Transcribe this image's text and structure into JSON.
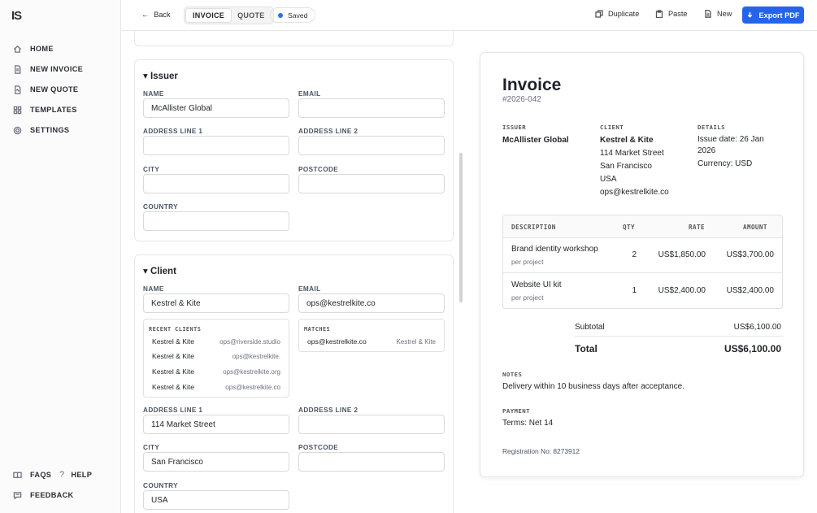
{
  "app": {
    "logo": "IS"
  },
  "sidebar": {
    "items": [
      {
        "label": "HOME",
        "icon": "home-icon"
      },
      {
        "label": "NEW INVOICE",
        "icon": "document-icon"
      },
      {
        "label": "NEW QUOTE",
        "icon": "quote-icon"
      },
      {
        "label": "TEMPLATES",
        "icon": "grid-icon"
      },
      {
        "label": "SETTINGS",
        "icon": "gear-icon"
      }
    ],
    "bottom": {
      "faqs": "FAQS",
      "help": "HELP",
      "feedback": "FEEDBACK"
    }
  },
  "toolbar": {
    "back": "Back",
    "tabs": [
      "INVOICE",
      "QUOTE"
    ],
    "saved": "Saved",
    "duplicate": "Duplicate",
    "paste": "Paste",
    "new": "New",
    "export": "Export PDF"
  },
  "issuer": {
    "title": "Issuer",
    "name_label": "NAME",
    "name": "McAllister Global",
    "email_label": "EMAIL",
    "email": "",
    "address1_label": "ADDRESS LINE 1",
    "address1": "",
    "address2_label": "ADDRESS LINE 2",
    "address2": "",
    "city_label": "CITY",
    "city": "",
    "postcode_label": "POSTCODE",
    "postcode": "",
    "country_label": "COUNTRY",
    "country": ""
  },
  "client": {
    "title": "Client",
    "name_label": "NAME",
    "name": "Kestrel & Kite",
    "email_label": "EMAIL",
    "email": "ops@kestrelkite.co",
    "recent_title": "RECENT CLIENTS",
    "recent": [
      {
        "name": "Kestrel & Kite",
        "email": "ops@riverside.studio"
      },
      {
        "name": "Kestrel & Kite",
        "email": "ops@kestrelkite."
      },
      {
        "name": "Kestrel & Kite",
        "email": "ops@kestrelkite.org"
      },
      {
        "name": "Kestrel & Kite",
        "email": "ops@kestrelkite.co"
      }
    ],
    "matches_title": "MATCHES",
    "matches": [
      {
        "email": "ops@kestrelkite.co",
        "name": "Kestrel & Kite"
      }
    ],
    "address1_label": "ADDRESS LINE 1",
    "address1": "114 Market Street",
    "address2_label": "ADDRESS LINE 2",
    "address2": "",
    "city_label": "CITY",
    "city": "San Francisco",
    "postcode_label": "POSTCODE",
    "postcode": "",
    "country_label": "COUNTRY",
    "country": "USA"
  },
  "preview": {
    "title": "Invoice",
    "number": "#2026-042",
    "issuer_label": "ISSUER",
    "issuer_name": "McAllister Global",
    "client_label": "CLIENT",
    "client_name": "Kestrel & Kite",
    "client_lines": [
      "114 Market Street",
      "San Francisco",
      "USA",
      "ops@kestrelkite.co"
    ],
    "details_label": "DETAILS",
    "issue_date_line1": "Issue date: 26 Jan",
    "issue_date_line2": "2026",
    "currency": "Currency: USD",
    "table_headers": {
      "description": "DESCRIPTION",
      "qty": "QTY",
      "rate": "RATE",
      "amount": "AMOUNT"
    },
    "items": [
      {
        "description": "Brand identity workshop",
        "unit": "per project",
        "qty": "2",
        "rate": "US$1,850.00",
        "amount": "US$3,700.00"
      },
      {
        "description": "Website UI kit",
        "unit": "per project",
        "qty": "1",
        "rate": "US$2,400.00",
        "amount": "US$2,400.00"
      }
    ],
    "subtotal_label": "Subtotal",
    "subtotal": "US$6,100.00",
    "total_label": "Total",
    "total": "US$6,100.00",
    "notes_label": "NOTES",
    "notes": "Delivery within 10 business days after acceptance.",
    "payment_label": "PAYMENT",
    "payment": "Terms: Net 14",
    "registration": "Registration No: 8273912"
  },
  "colors": {
    "accent": "#2563eb",
    "saved_dot": "#2f6fe4"
  }
}
